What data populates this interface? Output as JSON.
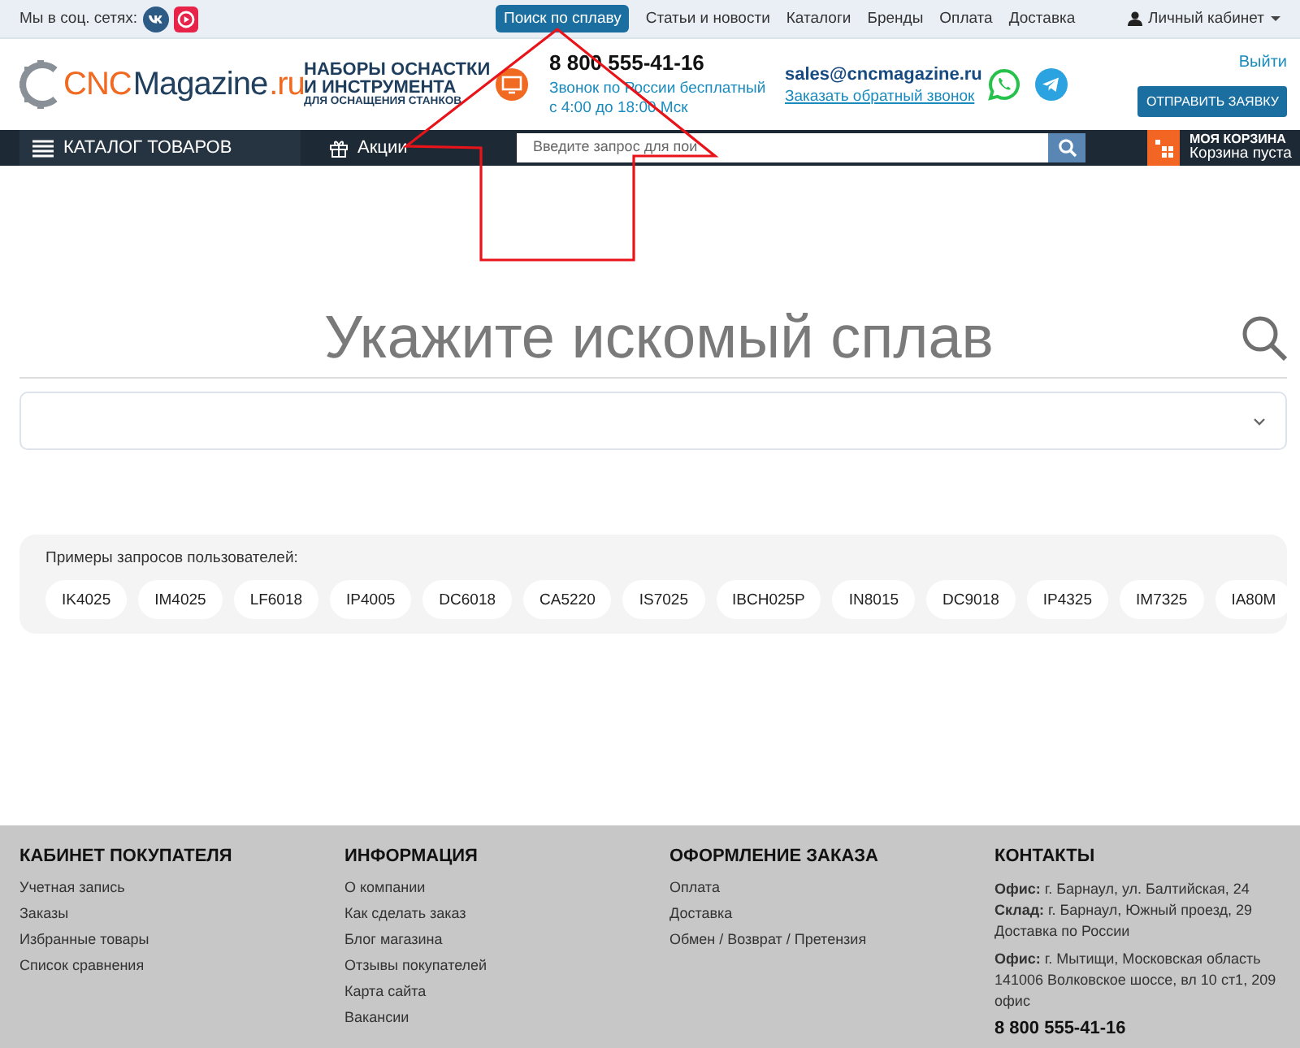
{
  "topbar": {
    "social_label": "Мы в соц. сетях:",
    "links": [
      {
        "label": "Поиск по сплаву",
        "selected": true
      },
      {
        "label": "Статьи и новости",
        "selected": false
      },
      {
        "label": "Каталоги",
        "selected": false
      },
      {
        "label": "Бренды",
        "selected": false
      },
      {
        "label": "Оплата",
        "selected": false
      },
      {
        "label": "Доставка",
        "selected": false
      }
    ],
    "account": "Личный кабинет"
  },
  "header": {
    "logo": {
      "part_1": "CNC",
      "part_2": "Magazine",
      "part_3": ".ru"
    },
    "promo": [
      "НАБОРЫ ОСНАСТКИ",
      "И ИНСТРУМЕНТА",
      "ДЛЯ ОСНАЩЕНИЯ СТАНКОВ"
    ],
    "phone": "8 800 555-41-16",
    "phone_note": [
      "Звонок по России бесплатный",
      "с 4:00 до 18:00 Мск"
    ],
    "email": "sales@cncmagazine.ru",
    "callback": "Заказать обратный звонок",
    "logout": "Выйти",
    "request_button": "ОТПРАВИТЬ ЗАЯВКУ"
  },
  "navbar": {
    "catalog": "КАТАЛОГ ТОВАРОВ",
    "promotions": "Акции",
    "search": {
      "placeholder": "Введите запрос для пои"
    },
    "cart": {
      "title": "МОЯ КОРЗИНА",
      "status": "Корзина пуста"
    }
  },
  "main": {
    "heading": "Укажите искомый сплав",
    "examples_label": "Примеры запросов пользователей:",
    "examples": [
      "IK4025",
      "IM4025",
      "LF6018",
      "IP4005",
      "DC6018",
      "CA5220",
      "IS7025",
      "IBCH025P",
      "IN8015",
      "DC9018",
      "IP4325",
      "IM7325",
      "IA80M"
    ]
  },
  "footer": {
    "columns": [
      {
        "title": "КАБИНЕТ ПОКУПАТЕЛЯ",
        "links": [
          "Учетная запись",
          "Заказы",
          "Избранные товары",
          "Список сравнения"
        ]
      },
      {
        "title": "ИНФОРМАЦИЯ",
        "links": [
          "О компании",
          "Как сделать заказ",
          "Блог магазина",
          "Отзывы покупателей",
          "Карта сайта",
          "Вакансии"
        ]
      },
      {
        "title": "ОФОРМЛЕНИЕ ЗАКАЗА",
        "links": [
          "Оплата",
          "Доставка",
          "Обмен / Возврат / Претензия"
        ]
      }
    ],
    "contacts": {
      "title": "КОНТАКТЫ",
      "blocks": [
        "**Офис:** г. Барнаул, ул. Балтийская, 24\n**Склад:** г. Барнаул, Южный проезд, 29\nДоставка по России",
        "**Офис:** г. Мытищи, Московская область\n141006 Волковское шоссе, вл 10 ст1, 209 офис"
      ],
      "phone": "8 800 555-41-16"
    }
  }
}
